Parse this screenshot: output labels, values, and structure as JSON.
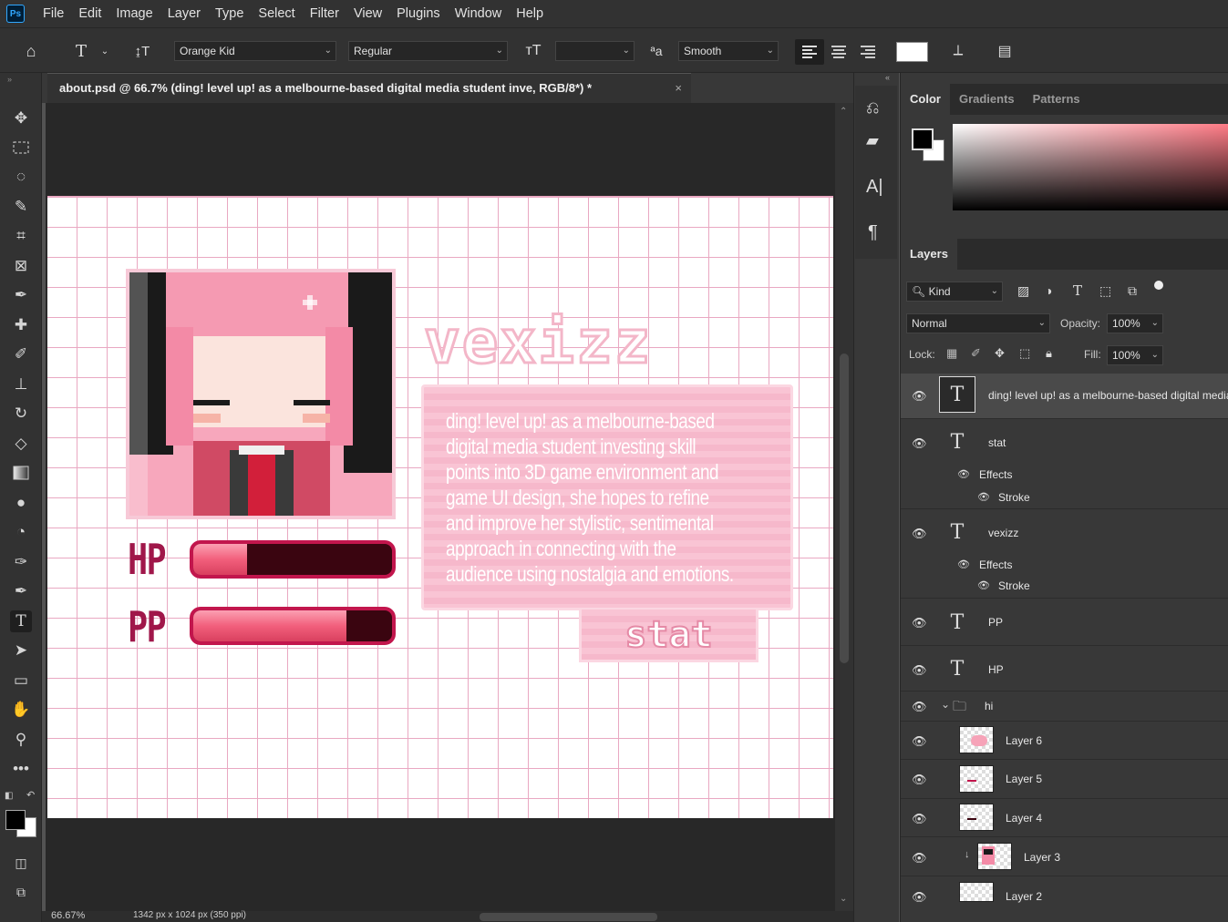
{
  "app": {
    "logo": "Ps"
  },
  "menu": [
    "File",
    "Edit",
    "Image",
    "Layer",
    "Type",
    "Select",
    "Filter",
    "View",
    "Plugins",
    "Window",
    "Help"
  ],
  "options": {
    "font_family": "Orange Kid",
    "font_style": "Regular",
    "font_size": "",
    "antialias": "Smooth"
  },
  "document": {
    "tab_title": "about.psd @ 66.7% (ding! level up! as a melbourne-based digital media student inve, RGB/8*) *",
    "close": "×"
  },
  "status": {
    "zoom": "66.67%",
    "doc_info": "1342 px x 1024 px (350 ppi)"
  },
  "artwork": {
    "name_title": "vexizz",
    "bio": "ding! level up! as a melbourne-based digital media student investing skill points into 3D game environment and game UI design, she hopes to refine and improve her stylistic, sentimental approach in connecting with the audience using nostalgia and emotions.",
    "bio_lines": [
      "ding! level up! as a melbourne-based",
      "digital media student investing skill",
      "points into 3D game environment and",
      "game UI design, she hopes to refine",
      "and improve her stylistic, sentimental",
      "approach in connecting with the",
      "audience using nostalgia and emotions."
    ],
    "stat_button": "stat",
    "hp_label": "HP",
    "pp_label": "PP",
    "hp_fill": 0.27,
    "pp_fill": 0.77,
    "colors": {
      "grid": "#e9a8c2",
      "panel": "#f9c4d4",
      "bar_fill": "#f25f7c",
      "bar_empty": "#3a0510",
      "label": "#a0174a"
    }
  },
  "color_panel": {
    "tabs": [
      "Color",
      "Gradients",
      "Patterns"
    ],
    "active": "Color",
    "fg": "#000000",
    "bg": "#ffffff",
    "hue": "#ff7b86"
  },
  "layers_panel": {
    "tab": "Layers",
    "filter": "Kind",
    "blend": "Normal",
    "opacity_label": "Opacity:",
    "opacity": "100%",
    "lock_label": "Lock:",
    "fill_label": "Fill:",
    "fill": "100%",
    "layers": [
      {
        "name": "ding! level up! as a melbourne-based digital media",
        "type": "text",
        "selected": true
      },
      {
        "name": "stat",
        "type": "text",
        "effects": [
          "Stroke"
        ]
      },
      {
        "name": "vexizz",
        "type": "text",
        "effects": [
          "Stroke"
        ]
      },
      {
        "name": "PP",
        "type": "text"
      },
      {
        "name": "HP",
        "type": "text"
      },
      {
        "name": "hi",
        "type": "group"
      },
      {
        "name": "Layer 6",
        "type": "image"
      },
      {
        "name": "Layer 5",
        "type": "image"
      },
      {
        "name": "Layer 4",
        "type": "image"
      },
      {
        "name": "Layer 3",
        "type": "image",
        "clipped": true
      },
      {
        "name": "Layer 2",
        "type": "image"
      }
    ],
    "effects_label": "Effects",
    "stroke_label": "Stroke"
  }
}
